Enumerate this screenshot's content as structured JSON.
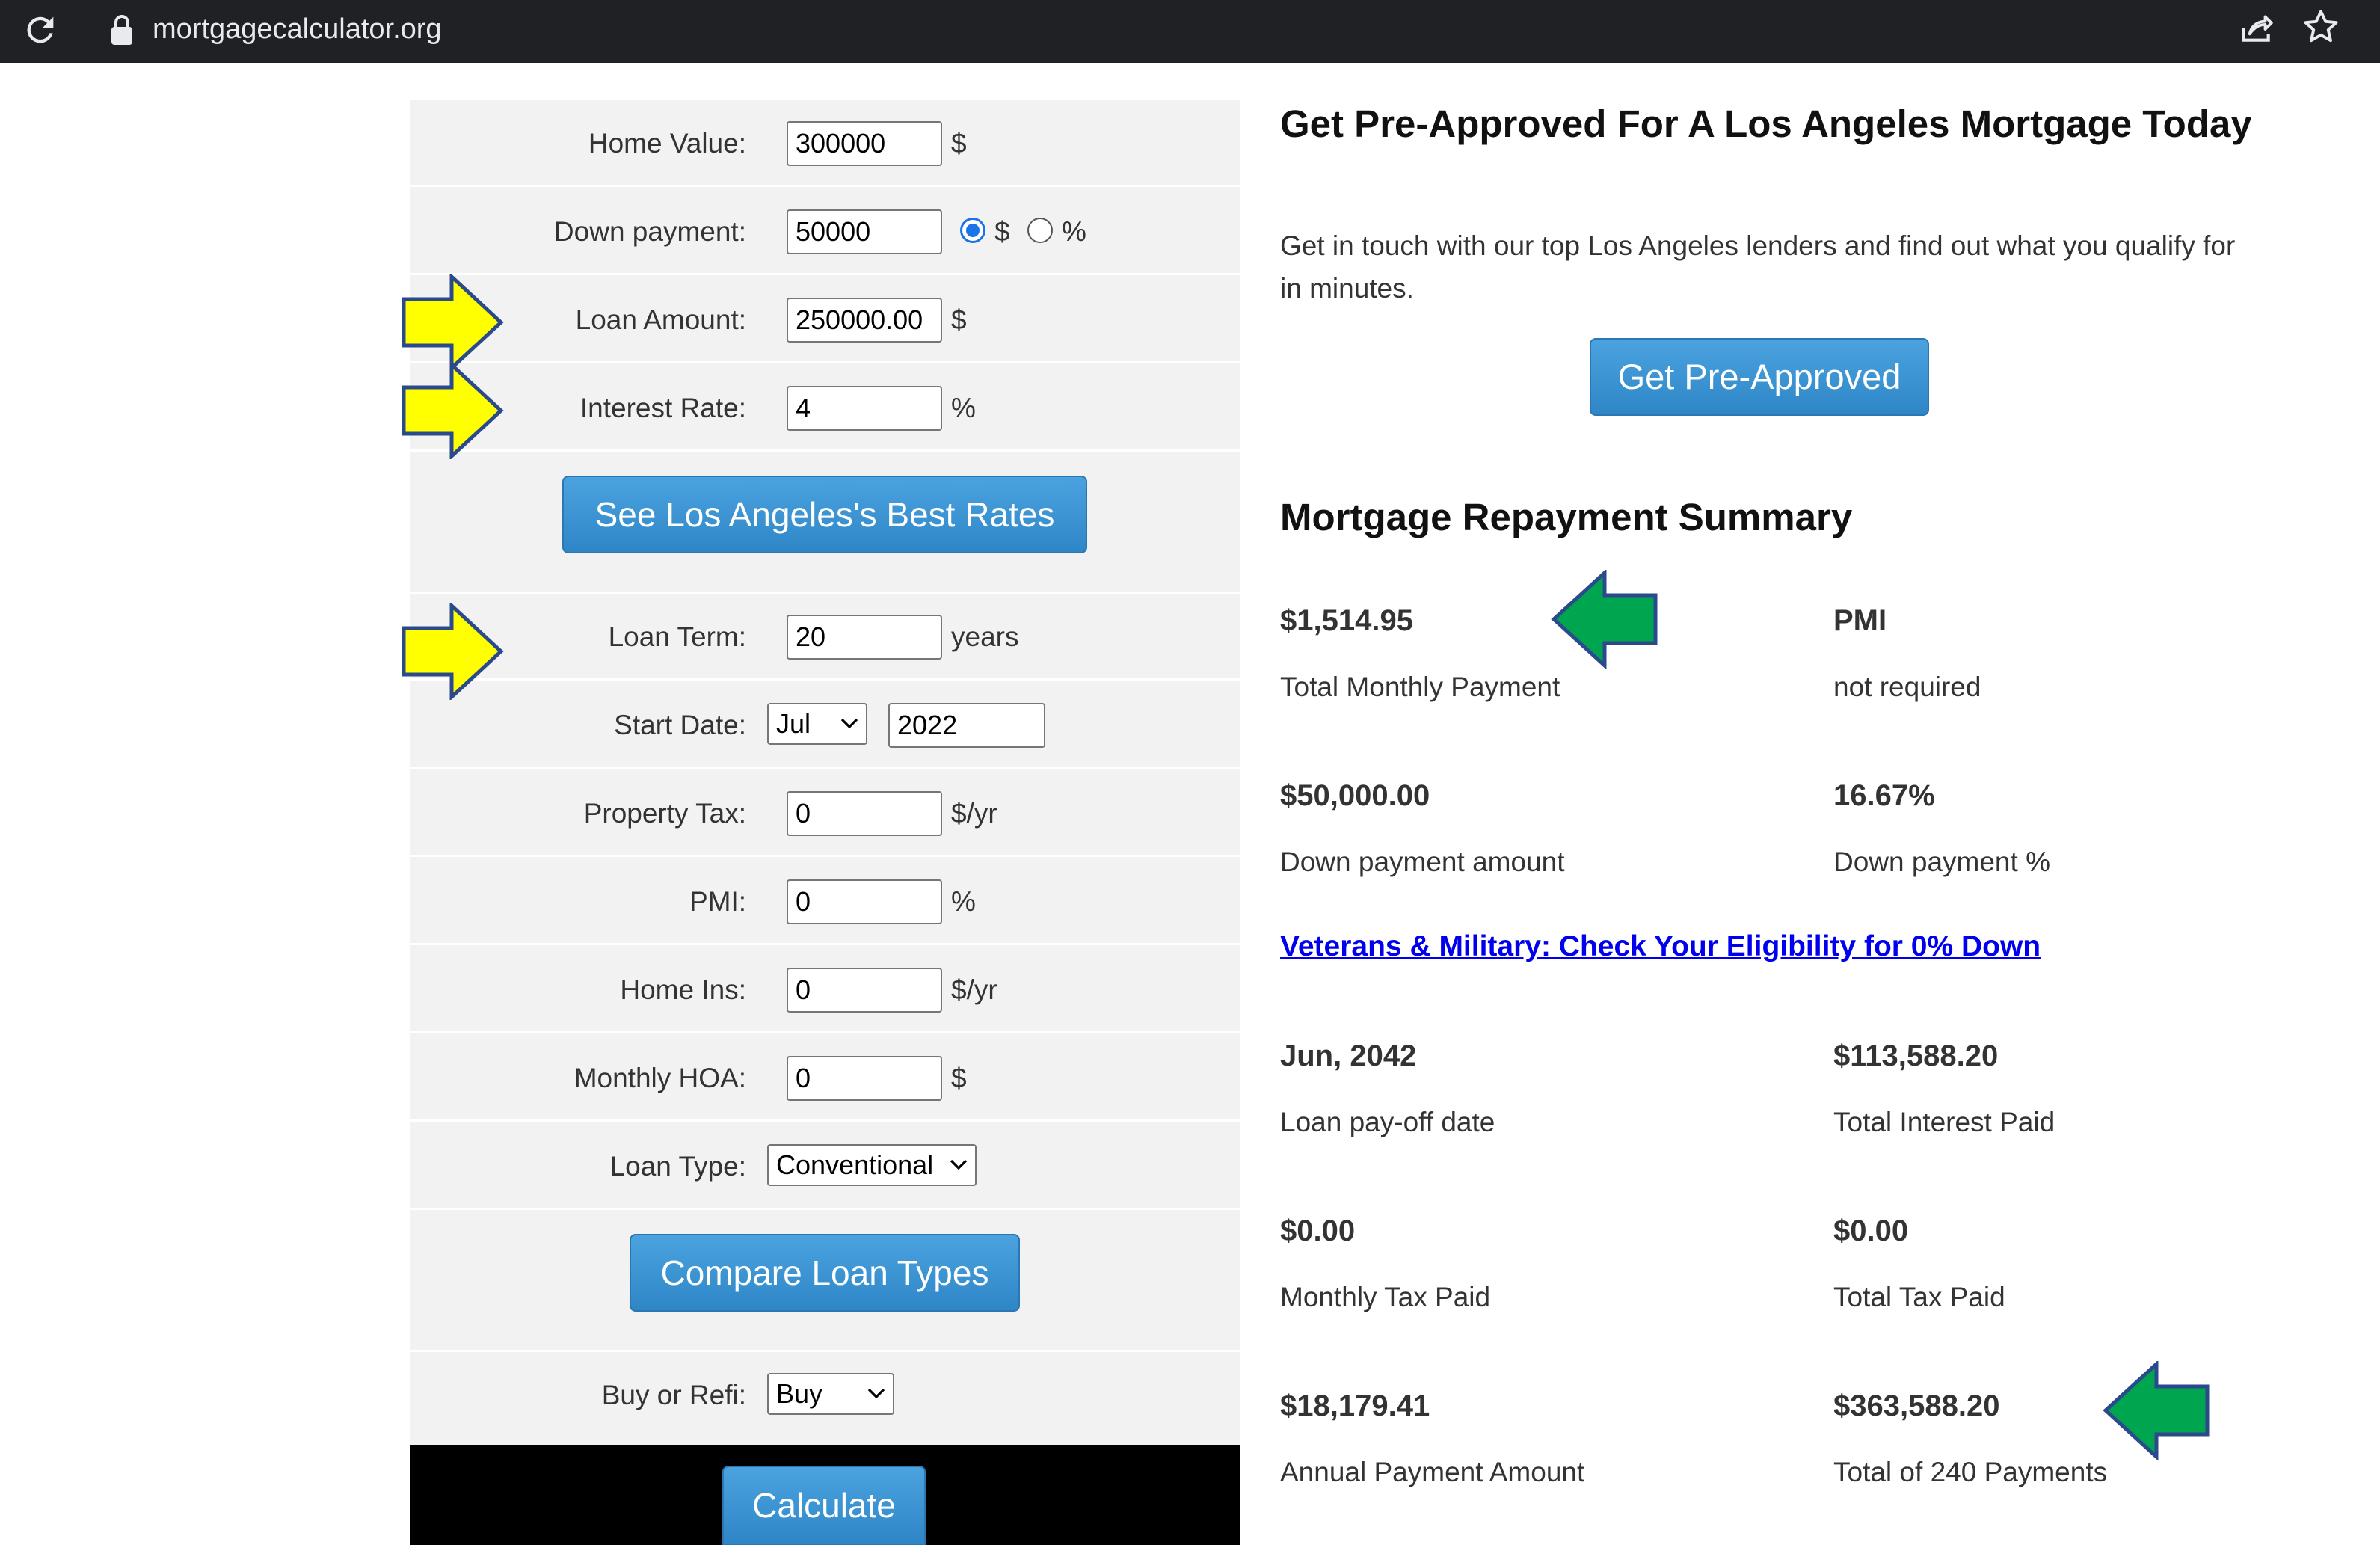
{
  "browser": {
    "url": "mortgagecalculator.org"
  },
  "form": {
    "rows": [
      {
        "label": "Home Value:",
        "value": "300000",
        "unit": "$"
      },
      {
        "label": "Down payment:",
        "value": "50000",
        "unit_dollar": "$",
        "unit_percent": "%",
        "selected_unit": "$"
      },
      {
        "label": "Loan Amount:",
        "value": "250000.00",
        "unit": "$"
      },
      {
        "label": "Interest Rate:",
        "value": "4",
        "unit": "%"
      },
      {
        "label": "Loan Term:",
        "value": "20",
        "unit": "years"
      },
      {
        "label": "Start Date:",
        "month": "Jul",
        "year": "2022"
      },
      {
        "label": "Property Tax:",
        "value": "0",
        "unit": "$/yr"
      },
      {
        "label": "PMI:",
        "value": "0",
        "unit": "%"
      },
      {
        "label": "Home Ins:",
        "value": "0",
        "unit": "$/yr"
      },
      {
        "label": "Monthly HOA:",
        "value": "0",
        "unit": "$"
      },
      {
        "label": "Loan Type:",
        "selected": "Conventional"
      },
      {
        "label": "Buy or Refi:",
        "selected": "Buy"
      }
    ],
    "best_rates_button": "See Los Angeles's Best Rates",
    "compare_button": "Compare Loan Types",
    "calculate_button": "Calculate"
  },
  "promo": {
    "title": "Get Pre-Approved For A Los Angeles Mortgage Today",
    "text": "Get in touch with our top Los Angeles lenders and find out what you qualify for in minutes.",
    "button": "Get Pre-Approved"
  },
  "summary": {
    "heading": "Mortgage Repayment Summary",
    "items": [
      {
        "value": "$1,514.95",
        "label": "Total Monthly Payment"
      },
      {
        "value": "PMI",
        "label": "not required"
      },
      {
        "value": "$50,000.00",
        "label": "Down payment amount"
      },
      {
        "value": "16.67%",
        "label": "Down payment %"
      },
      {
        "value": "Jun, 2042",
        "label": "Loan pay-off date"
      },
      {
        "value": "$113,588.20",
        "label": "Total Interest Paid"
      },
      {
        "value": "$0.00",
        "label": "Monthly Tax Paid"
      },
      {
        "value": "$0.00",
        "label": "Total Tax Paid"
      },
      {
        "value": "$18,179.41",
        "label": "Annual Payment Amount"
      },
      {
        "value": "$363,588.20",
        "label": "Total of 240 Payments"
      }
    ],
    "va_link": "Veterans & Military: Check Your Eligibility for 0% Down"
  },
  "annotations": {
    "yellow_arrows": [
      "loan-amount",
      "interest-rate",
      "loan-term"
    ],
    "green_arrows": [
      "total-monthly-payment",
      "total-of-payments"
    ],
    "yellow_color": "#ffff00",
    "green_color": "#00a550",
    "arrow_outline": "#2b4a8c"
  }
}
